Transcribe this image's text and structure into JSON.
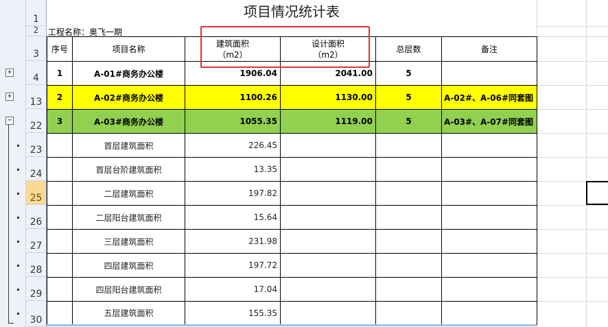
{
  "sheet": {
    "title": "项目情况统计表",
    "project_name": "工程名称：奥飞一期",
    "headers": {
      "seq": "序号",
      "name": "项目名称",
      "build_area": "建筑面积",
      "build_unit": "（m2）",
      "design_area": "设计面积",
      "design_unit": "（m2）",
      "floors": "总层数",
      "note": "备注"
    },
    "row_numbers": [
      "1",
      "2",
      "3",
      "4",
      "13",
      "22",
      "23",
      "24",
      "25",
      "26",
      "27",
      "28",
      "29",
      "30"
    ],
    "selected_row": "25",
    "main_rows": [
      {
        "seq": "1",
        "name": "A-01#商务办公楼",
        "build": "1906.04",
        "design": "2041.00",
        "floors": "5",
        "note": ""
      },
      {
        "seq": "2",
        "name": "A-02#商务办公楼",
        "build": "1100.26",
        "design": "1130.00",
        "floors": "5",
        "note": "A-02#、A-06#同套图"
      },
      {
        "seq": "3",
        "name": "A-03#商务办公楼",
        "build": "1055.35",
        "design": "1119.00",
        "floors": "5",
        "note": "A-03#、A-07#同套图"
      }
    ],
    "detail_rows": [
      {
        "name": "首层建筑面积",
        "value": "226.45"
      },
      {
        "name": "首层台阶建筑面积",
        "value": "13.35"
      },
      {
        "name": "二层建筑面积",
        "value": "197.82"
      },
      {
        "name": "二层阳台建筑面积",
        "value": "15.64"
      },
      {
        "name": "三层建筑面积",
        "value": "231.98"
      },
      {
        "name": "四层建筑面积",
        "value": "197.72"
      },
      {
        "name": "四层阳台建筑面积",
        "value": "17.04"
      },
      {
        "name": "五层建筑面积",
        "value": "155.35"
      }
    ]
  },
  "outline": {
    "expand_symbol": "+",
    "collapse_symbol": "−"
  },
  "colors": {
    "highlight_yellow": "#ffff00",
    "highlight_green": "#92d050",
    "annotation_red": "#e53333",
    "selected_row_header": "#f9d995"
  }
}
